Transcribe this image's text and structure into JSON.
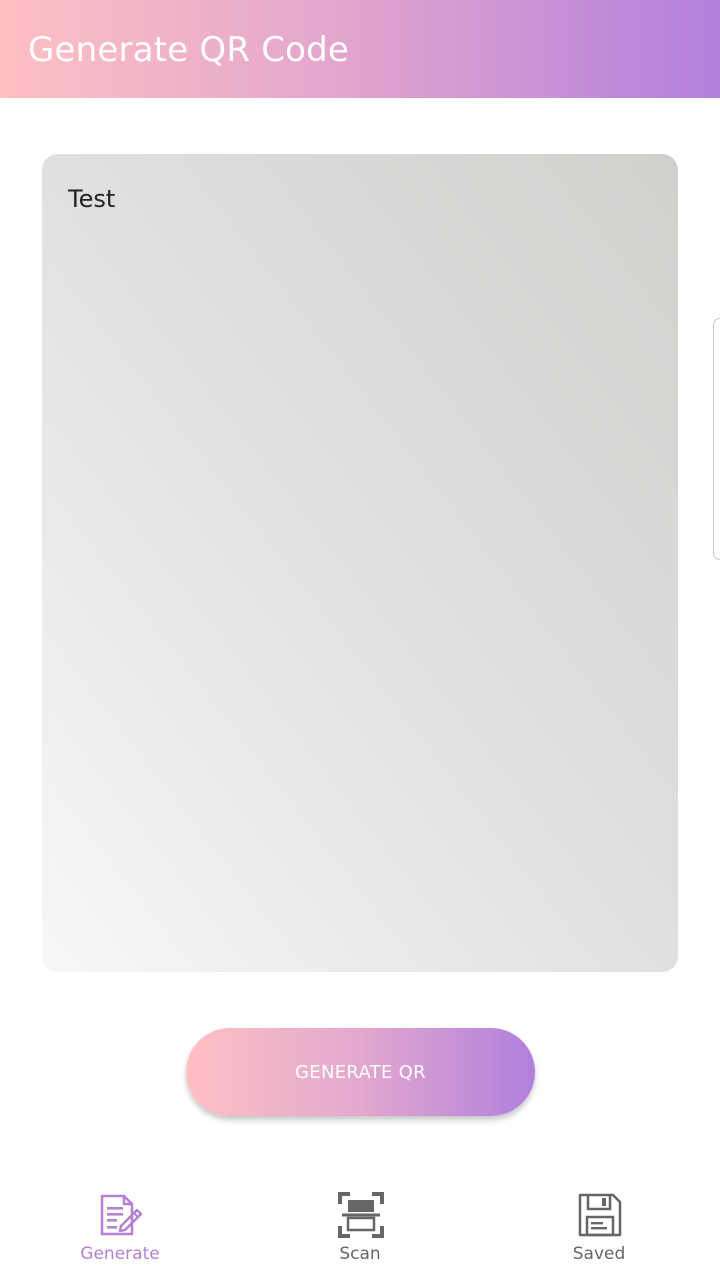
{
  "app_bar": {
    "title": "Generate QR Code"
  },
  "input": {
    "value": "Test"
  },
  "actions": {
    "generate_label": "GENERATE QR"
  },
  "bottom_nav": {
    "items": [
      {
        "label": "Generate",
        "icon": "edit-document-icon",
        "active": true
      },
      {
        "label": "Scan",
        "icon": "scan-icon",
        "active": false
      },
      {
        "label": "Saved",
        "icon": "floppy-disk-icon",
        "active": false
      }
    ]
  },
  "colors": {
    "gradient_start": "#fec0c3",
    "gradient_end": "#b37fdd",
    "active_nav": "#b380d6",
    "inactive_nav": "#666666"
  }
}
